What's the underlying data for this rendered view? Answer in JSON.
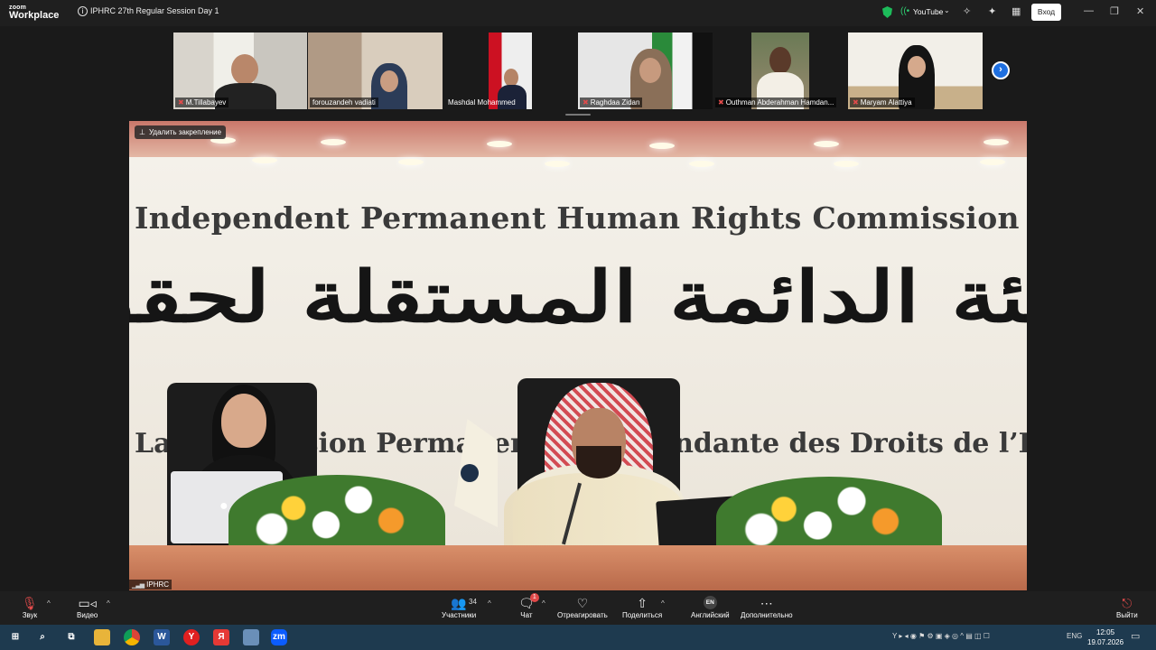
{
  "app": {
    "logo_line1": "zoom",
    "logo_line2": "Workplace",
    "meeting_title": "IPHRC 27th Regular Session Day 1",
    "stream_label": "YouTube",
    "login_button": "Вход"
  },
  "gallery": {
    "participants": [
      {
        "name": "M.Tillabayev",
        "muted": true
      },
      {
        "name": "forouzandeh vadiati",
        "muted": true
      },
      {
        "name": "Mashdal Mohammed",
        "muted": false
      },
      {
        "name": "Raghdaa Zidan",
        "muted": true
      },
      {
        "name": "Outhman Abderahman Hamdan...",
        "muted": true
      },
      {
        "name": "Maryam Alattiya",
        "muted": true
      }
    ]
  },
  "main_video": {
    "unpin_label": "Удалить закрепление",
    "speaker_name": "IPHRC",
    "banner_english": "Independent Permanent Human Rights Commission",
    "banner_arabic": "الهيئة الدائمة المستقلة لحقوق الإنسان",
    "banner_french": "La Commission Permanente Indépendante des Droits de l’Homme"
  },
  "toolbar": {
    "audio_label": "Звук",
    "video_label": "Видео",
    "participants_label": "Участники",
    "participants_count": "34",
    "chat_label": "Чат",
    "chat_badge": "1",
    "react_label": "Отреагировать",
    "share_label": "Поделиться",
    "interpretation_label": "Английский",
    "interpretation_code": "EN",
    "more_label": "Дополнительно",
    "leave_label": "Выйти"
  },
  "taskbar": {
    "language": "ENG",
    "time": "12:05",
    "date": "19.07.2026"
  },
  "colors": {
    "accent": "#1e6fe0",
    "muted_red": "#e24b4b",
    "taskbar": "#1e3a4f"
  }
}
